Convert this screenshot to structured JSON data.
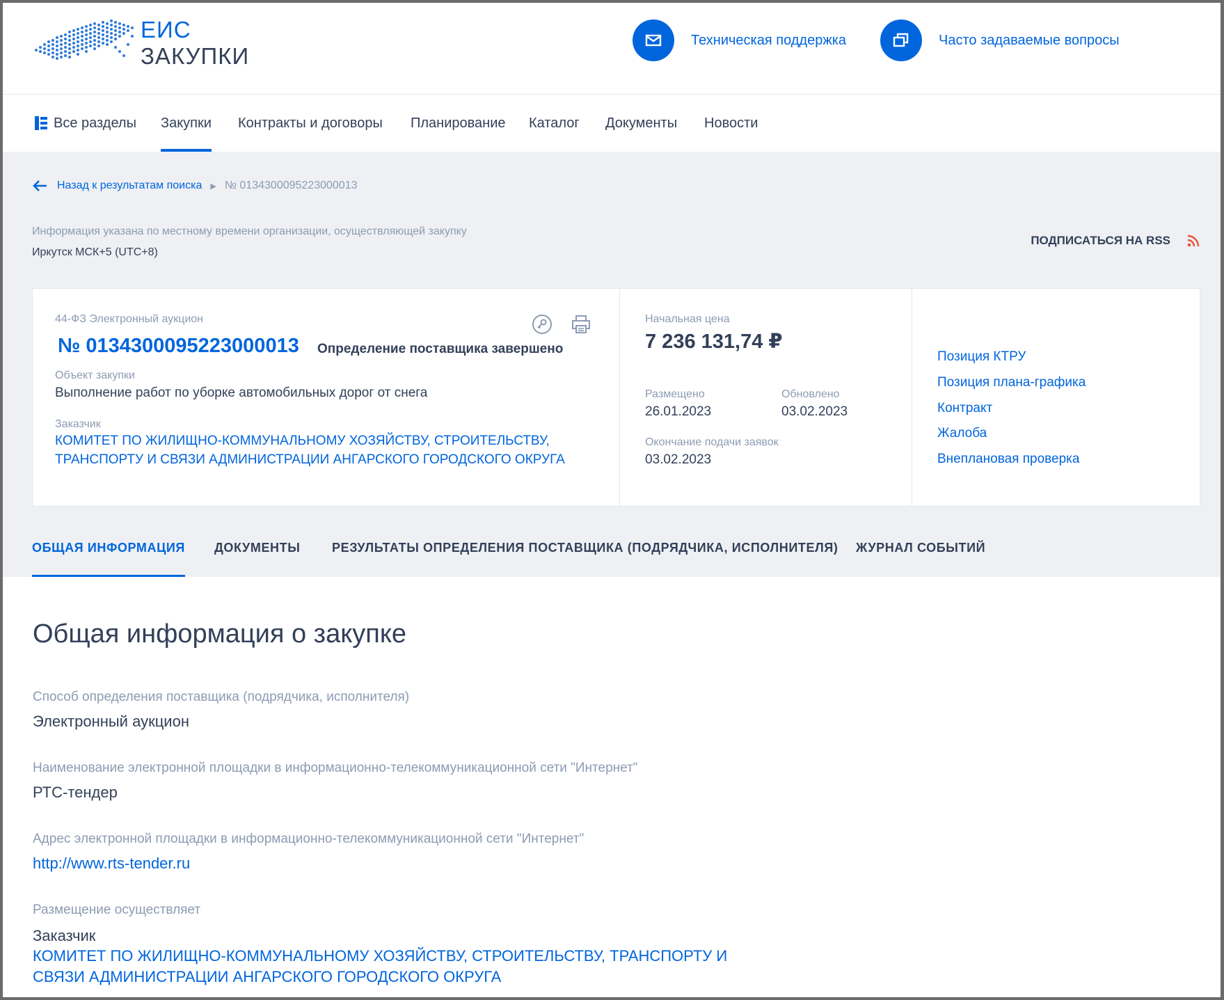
{
  "brand": {
    "line1": "ЕИС",
    "line2": "ЗАКУПКИ"
  },
  "header_links": {
    "support": "Техническая поддержка",
    "faq": "Часто задаваемые вопросы"
  },
  "nav": {
    "all_sections": "Все разделы",
    "items": [
      "Закупки",
      "Контракты и договоры",
      "Планирование",
      "Каталог",
      "Документы",
      "Новости"
    ]
  },
  "breadcrumb": {
    "back": "Назад к результатам поиска",
    "current": "№ 0134300095223000013"
  },
  "timezone": {
    "note": "Информация указана по местному времени организации, осуществляющей закупку",
    "value": "Иркутск МСК+5 (UTC+8)"
  },
  "rss": {
    "label": "ПОДПИСАТЬСЯ НА RSS"
  },
  "card": {
    "type": "44-ФЗ Электронный аукцион",
    "number": "№ 0134300095223000013",
    "status": "Определение поставщика завершено",
    "object_label": "Объект закупки",
    "object_value": "Выполнение работ по уборке автомобильных дорог от снега",
    "customer_label": "Заказчик",
    "customer_line1": "КОМИТЕТ ПО ЖИЛИЩНО-КОММУНАЛЬНОМУ ХОЗЯЙСТВУ, СТРОИТЕЛЬСТВУ,",
    "customer_line2": "ТРАНСПОРТУ И СВЯЗИ АДМИНИСТРАЦИИ АНГАРСКОГО ГОРОДСКОГО ОКРУГА",
    "price_label": "Начальная цена",
    "price_value": "7 236 131,74 ₽",
    "posted_label": "Размещено",
    "posted_value": "26.01.2023",
    "updated_label": "Обновлено",
    "updated_value": "03.02.2023",
    "deadline_label": "Окончание подачи заявок",
    "deadline_value": "03.02.2023",
    "side_links": [
      "Позиция КТРУ",
      "Позиция плана-графика",
      "Контракт",
      "Жалоба",
      "Внеплановая проверка"
    ]
  },
  "tabs": [
    "ОБЩАЯ ИНФОРМАЦИЯ",
    "ДОКУМЕНТЫ",
    "РЕЗУЛЬТАТЫ ОПРЕДЕЛЕНИЯ ПОСТАВЩИКА (ПОДРЯДЧИКА, ИСПОЛНИТЕЛЯ)",
    "ЖУРНАЛ СОБЫТИЙ"
  ],
  "general": {
    "title": "Общая информация о закупке",
    "method_label": "Способ определения поставщика (подрядчика, исполнителя)",
    "method_value": "Электронный аукцион",
    "platform_name_label": "Наименование электронной площадки в информационно-телекоммуникационной сети \"Интернет\"",
    "platform_name_value": "РТС-тендер",
    "platform_url_label": "Адрес электронной площадки в информационно-телекоммуникационной сети \"Интернет\"",
    "platform_url_value": "http://www.rts-tender.ru",
    "placer_label": "Размещение осуществляет",
    "placer_role": "Заказчик",
    "placer_line1": "КОМИТЕТ ПО ЖИЛИЩНО-КОММУНАЛЬНОМУ ХОЗЯЙСТВУ, СТРОИТЕЛЬСТВУ, ТРАНСПОРТУ И",
    "placer_line2": "СВЯЗИ АДМИНИСТРАЦИИ АНГАРСКОГО ГОРОДСКОГО ОКРУГА"
  },
  "colors": {
    "accent": "#0065dd",
    "text": "#334059",
    "muted": "#8d9bb3",
    "rss": "#e8533a"
  }
}
